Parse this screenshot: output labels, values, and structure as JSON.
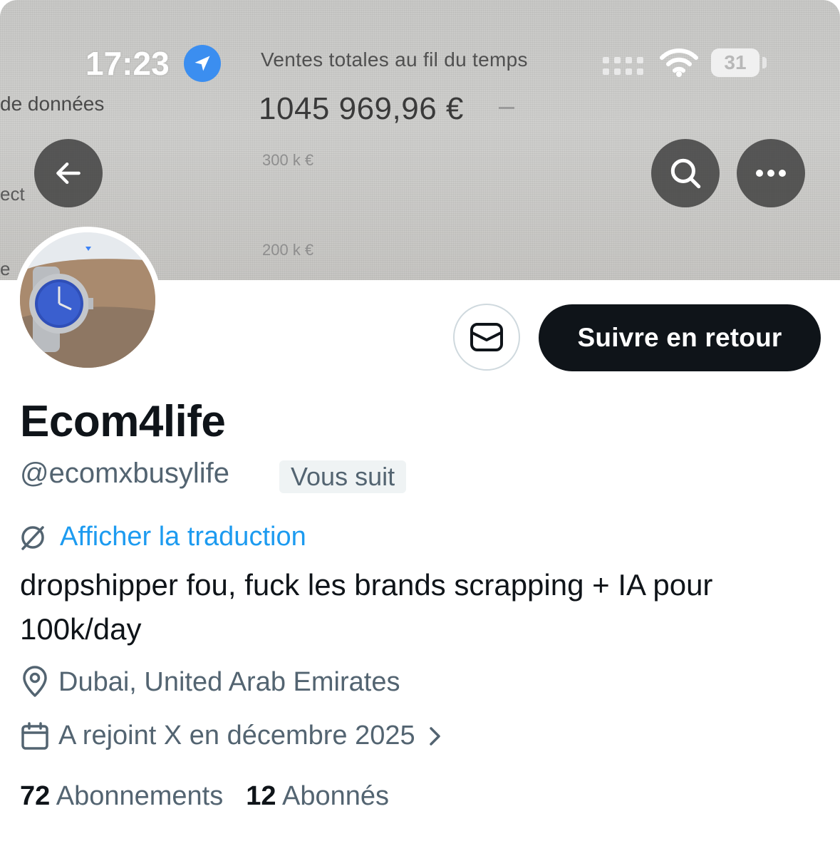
{
  "status_bar": {
    "time": "17:23",
    "battery": "31"
  },
  "banner": {
    "title": "Ventes totales au fil du temps",
    "total": "1045 969,96 €",
    "tick_top": "300 k €",
    "tick_bottom": "200 k €",
    "left_fragment_1": "de données",
    "left_fragment_2": "ect",
    "left_fragment_3": "e"
  },
  "actions": {
    "follow_back_label": "Suivre en retour"
  },
  "profile": {
    "display_name": "Ecom4life",
    "handle": "@ecomxbusylife",
    "follows_you_badge": "Vous suit",
    "translate_link": "Afficher la traduction",
    "bio": "dropshipper fou, fuck les brands scrapping + IA pour 100k/day",
    "location": "Dubai, United Arab Emirates",
    "joined": "A rejoint X en décembre 2025"
  },
  "stats": {
    "following_count": "72",
    "following_label": "Abonnements",
    "followers_count": "12",
    "followers_label": "Abonnés"
  },
  "colors": {
    "accent_link": "#1d9bf0",
    "secondary_text": "#536471",
    "primary_text": "#0f1419",
    "location_icon_bg": "#3b8ef0"
  },
  "icons": [
    "location-arrow-icon",
    "wifi-icon",
    "back-arrow-icon",
    "search-icon",
    "more-icon",
    "mail-icon",
    "translate-icon",
    "map-pin-icon",
    "calendar-icon",
    "chevron-right-icon"
  ]
}
